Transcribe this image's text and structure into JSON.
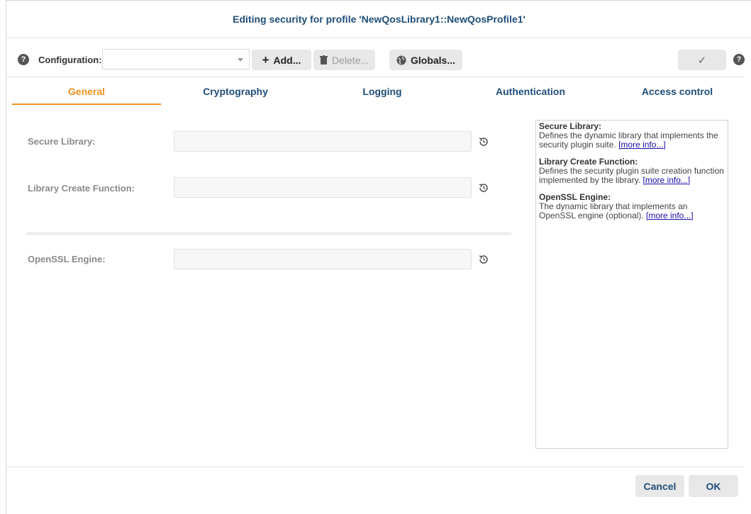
{
  "dialog": {
    "title": "Editing security for profile 'NewQosLibrary1::NewQosProfile1'"
  },
  "toolbar": {
    "help_glyph": "?",
    "configuration_label": "Configuration:",
    "configuration_value": "",
    "add_label": "Add...",
    "add_icon": "+",
    "delete_label": "Delete...",
    "globals_label": "Globals...",
    "apply_glyph": "✓"
  },
  "tabs": [
    {
      "label": "General",
      "active": true
    },
    {
      "label": "Cryptography",
      "active": false
    },
    {
      "label": "Logging",
      "active": false
    },
    {
      "label": "Authentication",
      "active": false
    },
    {
      "label": "Access control",
      "active": false
    }
  ],
  "form": {
    "secure_library": {
      "label": "Secure Library:",
      "value": ""
    },
    "library_create_function": {
      "label": "Library Create Function:",
      "value": ""
    },
    "openssl_engine": {
      "label": "OpenSSL Engine:",
      "value": ""
    }
  },
  "help": [
    {
      "heading": "Secure Library:",
      "text": "Defines the dynamic library that implements the security plugin suite. ",
      "link": "[more info...]"
    },
    {
      "heading": "Library Create Function:",
      "text": "Defines the security plugin suite creation function implemented by the library. ",
      "link": "[more info...]"
    },
    {
      "heading": "OpenSSL Engine:",
      "text": "The dynamic library that implements an OpenSSL engine (optional). ",
      "link": "[more info...]"
    }
  ],
  "footer": {
    "cancel_label": "Cancel",
    "ok_label": "OK"
  },
  "colors": {
    "accent": "#f0921e",
    "primary_text": "#1f4e79",
    "link": "#1a0dab"
  }
}
